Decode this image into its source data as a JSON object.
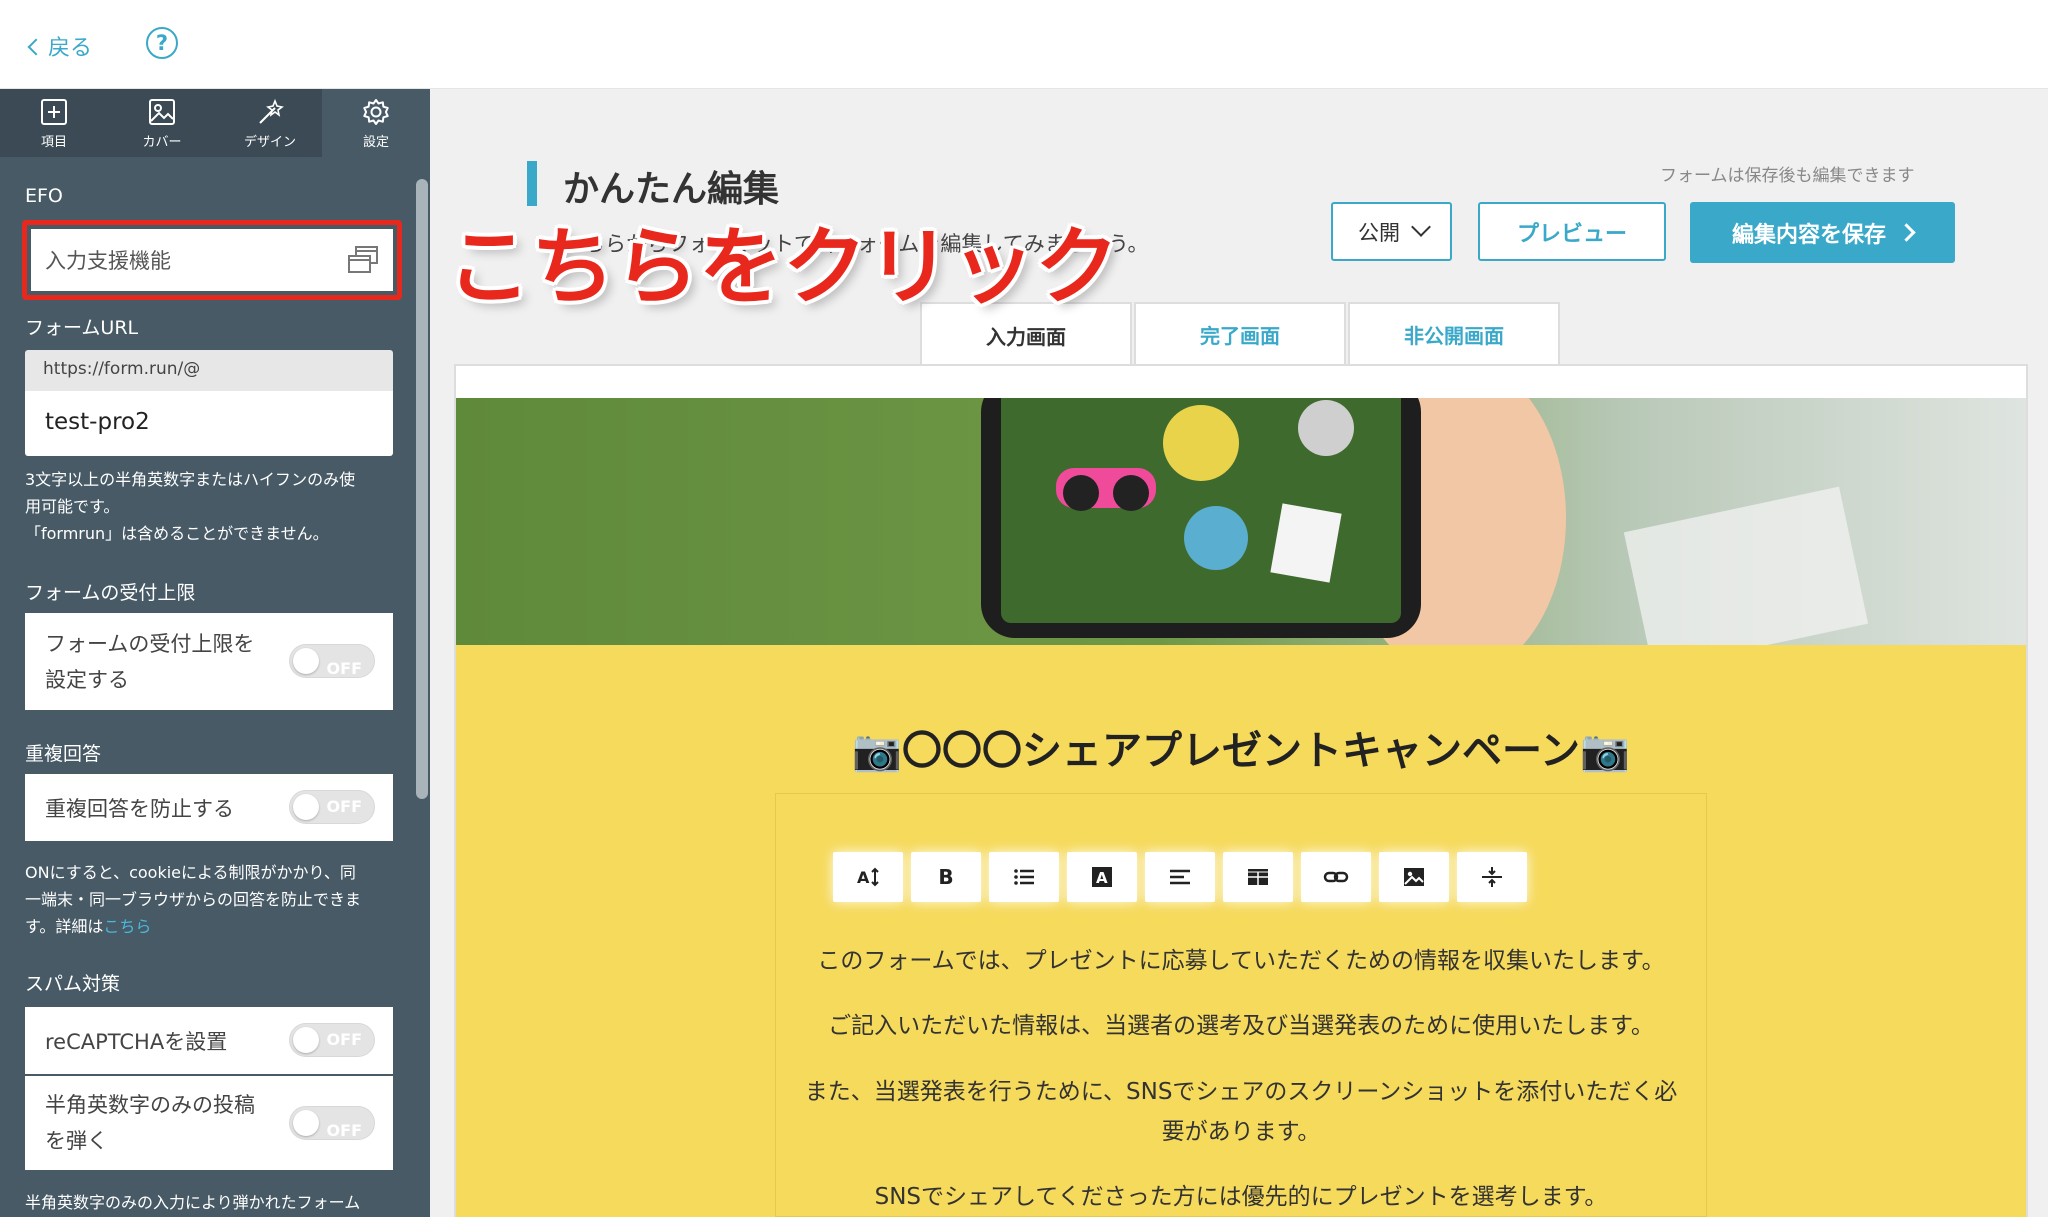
{
  "header": {
    "back_label": "戻る",
    "help_label": "?"
  },
  "sidebar": {
    "tabs": [
      {
        "label": "項目",
        "icon": "plus-square-icon"
      },
      {
        "label": "カバー",
        "icon": "image-icon"
      },
      {
        "label": "デザイン",
        "icon": "magic-wand-icon"
      },
      {
        "label": "設定",
        "icon": "gear-icon",
        "active": true
      }
    ],
    "efo": {
      "section": "EFO",
      "item": "入力支援機能"
    },
    "form_url": {
      "section": "フォームURL",
      "prefix": "https://form.run/@",
      "value": "test-pro2",
      "note_line1": "3文字以上の半角英数字またはハイフンのみ使",
      "note_line2": "用可能です。",
      "note_line3": "「formrun」は含めることができません。"
    },
    "limit": {
      "section": "フォームの受付上限",
      "label_line1": "フォームの受付上限を",
      "label_line2": "設定する",
      "state": "OFF"
    },
    "duplicate": {
      "section": "重複回答",
      "label": "重複回答を防止する",
      "state": "OFF",
      "note_line1": "ONにすると、cookieによる制限がかかり、同",
      "note_line2": "一端末・同一ブラウザからの回答を防止できま",
      "note_line3": "す。詳細は",
      "note_link": "こちら"
    },
    "spam": {
      "section": "スパム対策",
      "recaptcha_label": "reCAPTCHAを設置",
      "recaptcha_state": "OFF",
      "alnum_label_line1": "半角英数字のみの投稿",
      "alnum_label_line2": "を弾く",
      "alnum_state": "OFF",
      "note_line1": "半角英数字のみの入力により弾かれたフォーム"
    }
  },
  "main": {
    "title": "かんたん編集",
    "subtitle": "こちらからフォーマットで各フォームを編集してみましょう。",
    "save_note": "フォームは保存後も編集できます",
    "public_select": "公開",
    "preview_button": "プレビュー",
    "save_button": "編集内容を保存",
    "annotation": "こちらをクリック",
    "tabs": [
      {
        "label": "入力画面",
        "active": true
      },
      {
        "label": "完了画面"
      },
      {
        "label": "非公開画面"
      }
    ]
  },
  "form": {
    "title": "📷〇〇〇シェアプレゼントキャンペーン📷",
    "paragraphs": [
      "このフォームでは、プレゼントに応募していただくための情報を収集いたします。",
      "ご記入いただいた情報は、当選者の選考及び当選発表のために使用いたします。",
      "また、当選発表を行うために、SNSでシェアのスクリーンショットを添付いただく必",
      "要があります。",
      "SNSでシェアしてくださった方には優先的にプレゼントを選考します。"
    ],
    "toolbar": [
      "font-size-icon",
      "bold-icon",
      "list-icon",
      "text-color-icon",
      "align-icon",
      "table-icon",
      "link-icon",
      "image-icon",
      "hr-icon"
    ],
    "toolbar_bold_label": "B",
    "toolbar_text_color_label": "A"
  },
  "colors": {
    "accent": "#3aa9c9",
    "sidebar": "#475a66",
    "highlight": "#e8271d",
    "form_bg": "#f6da5c"
  }
}
